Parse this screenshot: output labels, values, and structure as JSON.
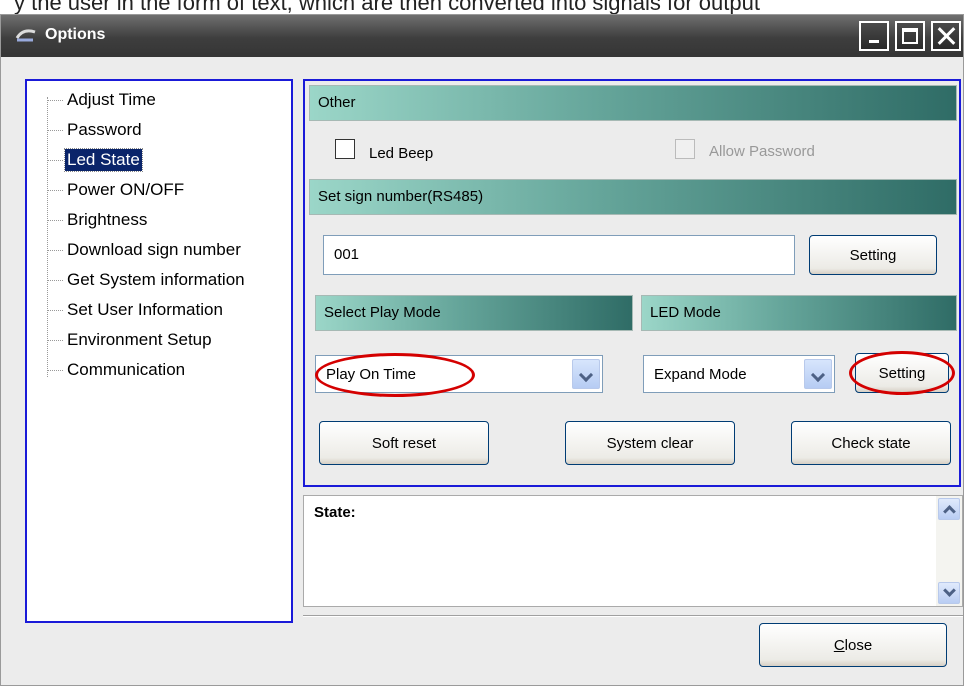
{
  "top_partial_text": "y the user in the form of text, which are then converted into signals for output",
  "window": {
    "title": "Options"
  },
  "tree": {
    "items": [
      {
        "label": "Adjust Time",
        "selected": false
      },
      {
        "label": "Password",
        "selected": false
      },
      {
        "label": "Led State",
        "selected": true
      },
      {
        "label": "Power ON/OFF",
        "selected": false
      },
      {
        "label": "Brightness",
        "selected": false
      },
      {
        "label": "Download sign number",
        "selected": false
      },
      {
        "label": "Get System information",
        "selected": false
      },
      {
        "label": "Set User Information",
        "selected": false
      },
      {
        "label": "Environment Setup",
        "selected": false
      },
      {
        "label": "Communication",
        "selected": false
      }
    ]
  },
  "other": {
    "header": "Other",
    "led_beep": {
      "label": "Led Beep",
      "checked": false
    },
    "allow_password": {
      "label": "Allow Password",
      "checked": false,
      "disabled": true
    }
  },
  "sign_number": {
    "header": "Set sign number(RS485)",
    "value": "001",
    "button": "Setting"
  },
  "play_mode": {
    "header": "Select Play  Mode",
    "selected": "Play On Time"
  },
  "led_mode": {
    "header": "LED Mode",
    "selected": "Expand Mode",
    "button": "Setting"
  },
  "actions": {
    "soft_reset": "Soft reset",
    "system_clear": "System clear",
    "check_state": "Check state"
  },
  "state": {
    "label": "State:"
  },
  "footer": {
    "close": "Close"
  },
  "colors": {
    "titlebar": "#3e3e3e",
    "tree_border": "#1a1ad8",
    "banner_start": "#9bd6c8",
    "banner_end": "#2f6c66",
    "highlight": "#d40000",
    "selection": "#0a246a"
  }
}
